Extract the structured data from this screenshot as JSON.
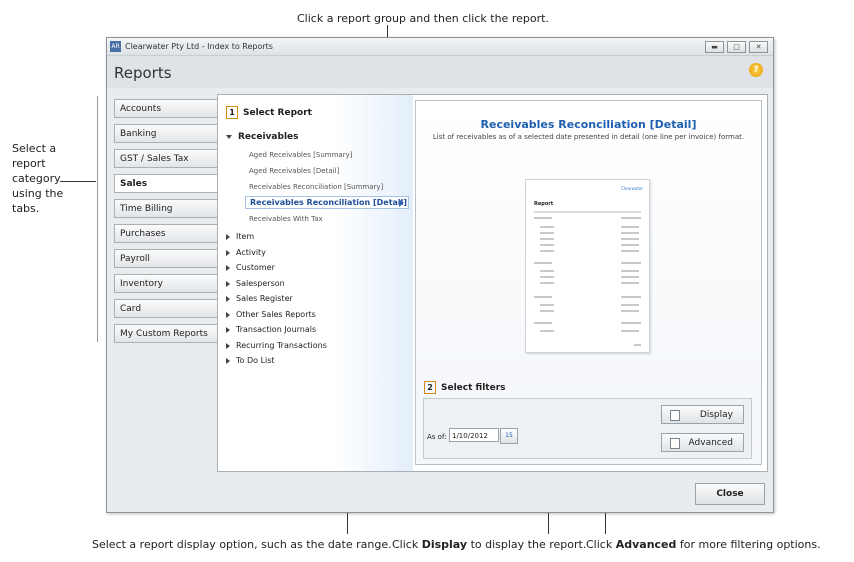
{
  "callouts": {
    "top": "Click a report group and then click the report.",
    "left": "Select a report category using the tabs.",
    "bottom_left": "Select a report display option, such as the date range.",
    "bottom_mid_pre": "Click ",
    "bottom_mid_bold": "Display",
    "bottom_mid_post": " to display the report.",
    "bottom_right_pre": "Click ",
    "bottom_right_bold": "Advanced",
    "bottom_right_post": " for more filtering options."
  },
  "window": {
    "title": "Clearwater Pty Ltd - Index to Reports",
    "app_icon": "AR",
    "page_title": "Reports",
    "help_icon": "?"
  },
  "tabs": [
    {
      "label": "Accounts"
    },
    {
      "label": "Banking"
    },
    {
      "label": "GST / Sales Tax"
    },
    {
      "label": "Sales",
      "active": true
    },
    {
      "label": "Time Billing"
    },
    {
      "label": "Purchases"
    },
    {
      "label": "Payroll"
    },
    {
      "label": "Inventory"
    },
    {
      "label": "Card"
    },
    {
      "label": "My Custom Reports"
    }
  ],
  "select_report": {
    "step": "1",
    "heading": "Select Report",
    "group": "Receivables",
    "reports": [
      "Aged Receivables [Summary]",
      "Aged Receivables [Detail]",
      "Receivables Reconciliation [Summary]",
      "Receivables Reconciliation [Detail]",
      "Receivables With Tax"
    ],
    "other_groups": [
      "Item",
      "Activity",
      "Customer",
      "Salesperson",
      "Sales Register",
      "Other Sales Reports",
      "Transaction Journals",
      "Recurring Transactions",
      "To Do List"
    ]
  },
  "report_preview": {
    "title": "Receivables Reconciliation [Detail]",
    "description": "List of receivables as of a selected date presented in detail (one line per invoice) format.",
    "thumb_heading": "Report",
    "thumb_company": "Clearwater"
  },
  "filters": {
    "step": "2",
    "heading": "Select filters",
    "as_of_label": "As of:",
    "as_of_value": "1/10/2012",
    "calendar_day": "15",
    "display_button": "Display",
    "advanced_button": "Advanced"
  },
  "close_button": "Close"
}
